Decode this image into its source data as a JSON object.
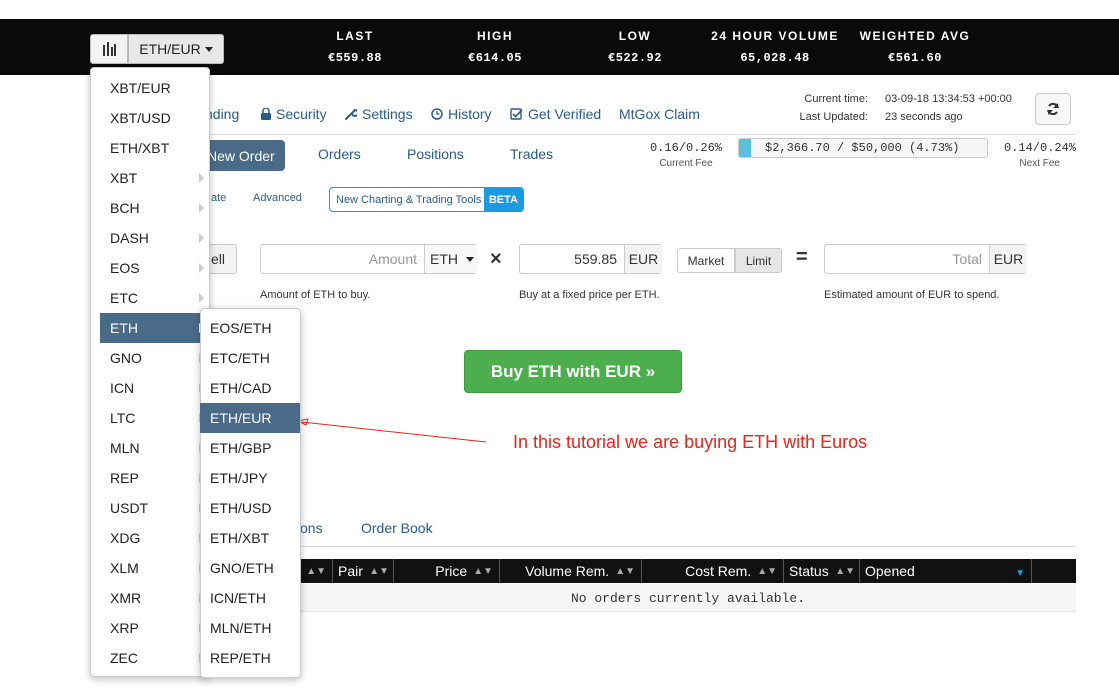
{
  "ticker": {
    "pair": "ETH/EUR",
    "stats": [
      {
        "label": "LAST",
        "value": "€559.88"
      },
      {
        "label": "HIGH",
        "value": "€614.05"
      },
      {
        "label": "LOW",
        "value": "€522.92"
      },
      {
        "label": "24 HOUR VOLUME",
        "value": "65,028.48"
      },
      {
        "label": "WEIGHTED AVG",
        "value": "€561.60"
      }
    ]
  },
  "nav": {
    "funding_partial": "nding",
    "security": "Security",
    "settings": "Settings",
    "history": "History",
    "get_verified": "Get Verified",
    "mtgox": "MtGox Claim"
  },
  "times": {
    "current_label": "Current time:",
    "current_value": "03-09-18 13:34:53 +00:00",
    "updated_label": "Last Updated:",
    "updated_value": "23 seconds ago"
  },
  "tabs": {
    "new_order": "New Order",
    "orders": "Orders",
    "positions": "Positions",
    "trades": "Trades"
  },
  "fees": {
    "current": "0.16/0.26%",
    "current_label": "Current Fee",
    "volume_text": "$2,366.70 / $50,000 (4.73%)",
    "volume_progress": 0.0473,
    "next": "0.14/0.24%",
    "next_label": "Next Fee"
  },
  "order_type": {
    "simple_partial": "ate",
    "advanced": "Advanced",
    "charting": "New Charting & Trading Tools",
    "beta": "BETA"
  },
  "form": {
    "sell_partial": "ell",
    "amount_placeholder": "Amount",
    "amount_currency": "ETH",
    "times_sign": "×",
    "price_value": "559.85",
    "price_currency": "EUR",
    "market": "Market",
    "limit": "Limit",
    "equals_sign": "=",
    "total_placeholder": "Total",
    "total_currency": "EUR",
    "amount_help": "Amount of ETH to buy.",
    "price_help": "Buy at a fixed price per ETH.",
    "total_help": "Estimated amount of EUR to spend.",
    "submit": "Buy ETH with EUR »"
  },
  "annotation": "In this tutorial we are buying ETH with Euros",
  "bottom_tabs": {
    "positions_partial": "ons",
    "order_book": "Order Book"
  },
  "table": {
    "headers": [
      "Pair",
      "Price",
      "Volume Rem.",
      "Cost Rem.",
      "Status",
      "Opened"
    ],
    "empty_message": "No orders currently available."
  },
  "menu": {
    "items": [
      "XBT/EUR",
      "XBT/USD",
      "ETH/XBT",
      "XBT",
      "BCH",
      "DASH",
      "EOS",
      "ETC",
      "ETH",
      "GNO",
      "ICN",
      "LTC",
      "MLN",
      "REP",
      "USDT",
      "XDG",
      "XLM",
      "XMR",
      "XRP",
      "ZEC"
    ],
    "submenu": [
      "EOS/ETH",
      "ETC/ETH",
      "ETH/CAD",
      "ETH/EUR",
      "ETH/GBP",
      "ETH/JPY",
      "ETH/USD",
      "ETH/XBT",
      "GNO/ETH",
      "ICN/ETH",
      "MLN/ETH",
      "REP/ETH"
    ],
    "active_item": "ETH",
    "active_subitem": "ETH/EUR"
  },
  "colors": {
    "topbar": "#0a0a0a",
    "link": "#2a5c8a",
    "active_menu": "#4a6b88",
    "buy_button": "#4cae4c",
    "annotation": "#e0281e",
    "beta": "#1a9ae0"
  }
}
